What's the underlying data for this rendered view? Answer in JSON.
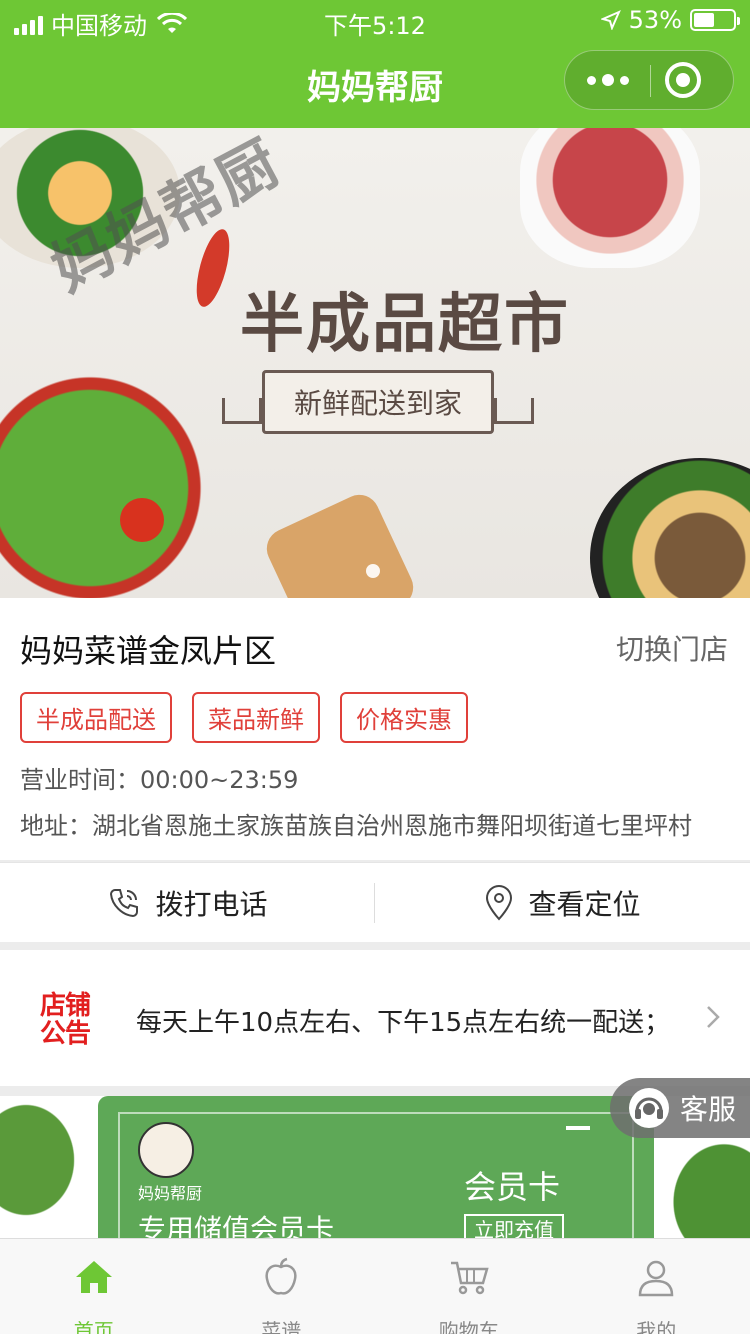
{
  "status_bar": {
    "carrier": "中国移动",
    "time": "下午5:12",
    "battery": "53%",
    "battery_level": 0.53
  },
  "nav": {
    "title": "妈妈帮厨"
  },
  "banner": {
    "watermark": "妈妈帮厨",
    "headline": "半成品超市",
    "ribbon": "新鲜配送到家"
  },
  "store": {
    "name": "妈妈菜谱金凤片区",
    "switch_label": "切换门店",
    "tags": [
      "半成品配送",
      "菜品新鲜",
      "价格实惠"
    ],
    "hours": "营业时间：00:00~23:59",
    "address": "地址：湖北省恩施土家族苗族自治州恩施市舞阳坝街道七里坪村"
  },
  "actions": {
    "call": "拨打电话",
    "location": "查看定位"
  },
  "notice": {
    "badge": "店铺公告",
    "text": "每天上午10点左右、下午15点左右统一配送；"
  },
  "member_card": {
    "brand": "妈妈帮厨",
    "title": "会员卡",
    "subtitle": "专用储值会员卡",
    "button": "立即充值"
  },
  "service": {
    "label": "客服"
  },
  "tabbar": {
    "items": [
      {
        "label": "首页",
        "icon": "home-icon",
        "active": true
      },
      {
        "label": "菜谱",
        "icon": "apple-icon",
        "active": false
      },
      {
        "label": "购物车",
        "icon": "cart-icon",
        "active": false
      },
      {
        "label": "我的",
        "icon": "user-icon",
        "active": false
      }
    ]
  },
  "colors": {
    "brand_green": "#6ec735",
    "tag_red": "#e0403a",
    "notice_red": "#e21f1f"
  }
}
